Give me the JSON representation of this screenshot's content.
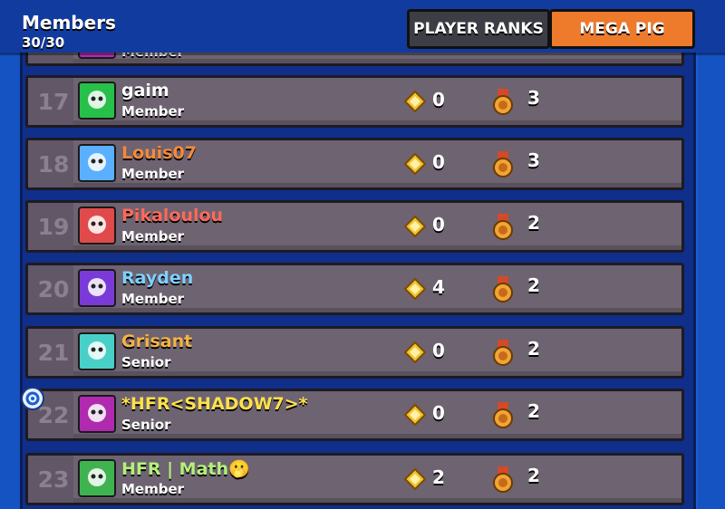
{
  "header": {
    "title": "Members",
    "count": "30/30",
    "tabs": [
      {
        "label": "PLAYER RANKS",
        "active": false
      },
      {
        "label": "MEGA PIG",
        "active": true
      }
    ]
  },
  "partial_row": {
    "role": "Member"
  },
  "members": [
    {
      "rank": "17",
      "name": "gaim",
      "name_color": "#ffffff",
      "role": "Member",
      "gems": "0",
      "medals": "3",
      "avatar_icon": "green-cactus-avatar-icon",
      "avatar_bg": "#27c04a"
    },
    {
      "rank": "18",
      "name": "Louis07",
      "name_color": "#f58a3a",
      "role": "Member",
      "gems": "0",
      "medals": "3",
      "avatar_icon": "sk-logo-avatar-icon",
      "avatar_bg": "#5ab0ff"
    },
    {
      "rank": "19",
      "name": "Pikaloulou",
      "name_color": "#ff6a5a",
      "role": "Member",
      "gems": "0",
      "medals": "2",
      "avatar_icon": "red-skull-avatar-icon",
      "avatar_bg": "#e04a4a"
    },
    {
      "rank": "20",
      "name": "Rayden",
      "name_color": "#7fd0ff",
      "role": "Member",
      "gems": "4",
      "medals": "2",
      "avatar_icon": "purple-skull-avatar-icon",
      "avatar_bg": "#7a3ad8"
    },
    {
      "rank": "21",
      "name": "Grisant",
      "name_color": "#f5b342",
      "role": "Senior",
      "gems": "0",
      "medals": "2",
      "avatar_icon": "skull-crossbones-avatar-icon",
      "avatar_bg": "#48d0c8"
    },
    {
      "rank": "22",
      "name": "*HFR<SHADOW7>*",
      "name_color": "#ffe14a",
      "role": "Senior",
      "gems": "0",
      "medals": "2",
      "avatar_icon": "navi-logo-avatar-icon",
      "avatar_bg": "#b02ab0"
    },
    {
      "rank": "23",
      "name": "HFR | Math🫢",
      "name_color": "#b5f07a",
      "role": "Member",
      "gems": "2",
      "medals": "2",
      "avatar_icon": "green-spike-avatar-icon",
      "avatar_bg": "#3fb34f"
    }
  ]
}
